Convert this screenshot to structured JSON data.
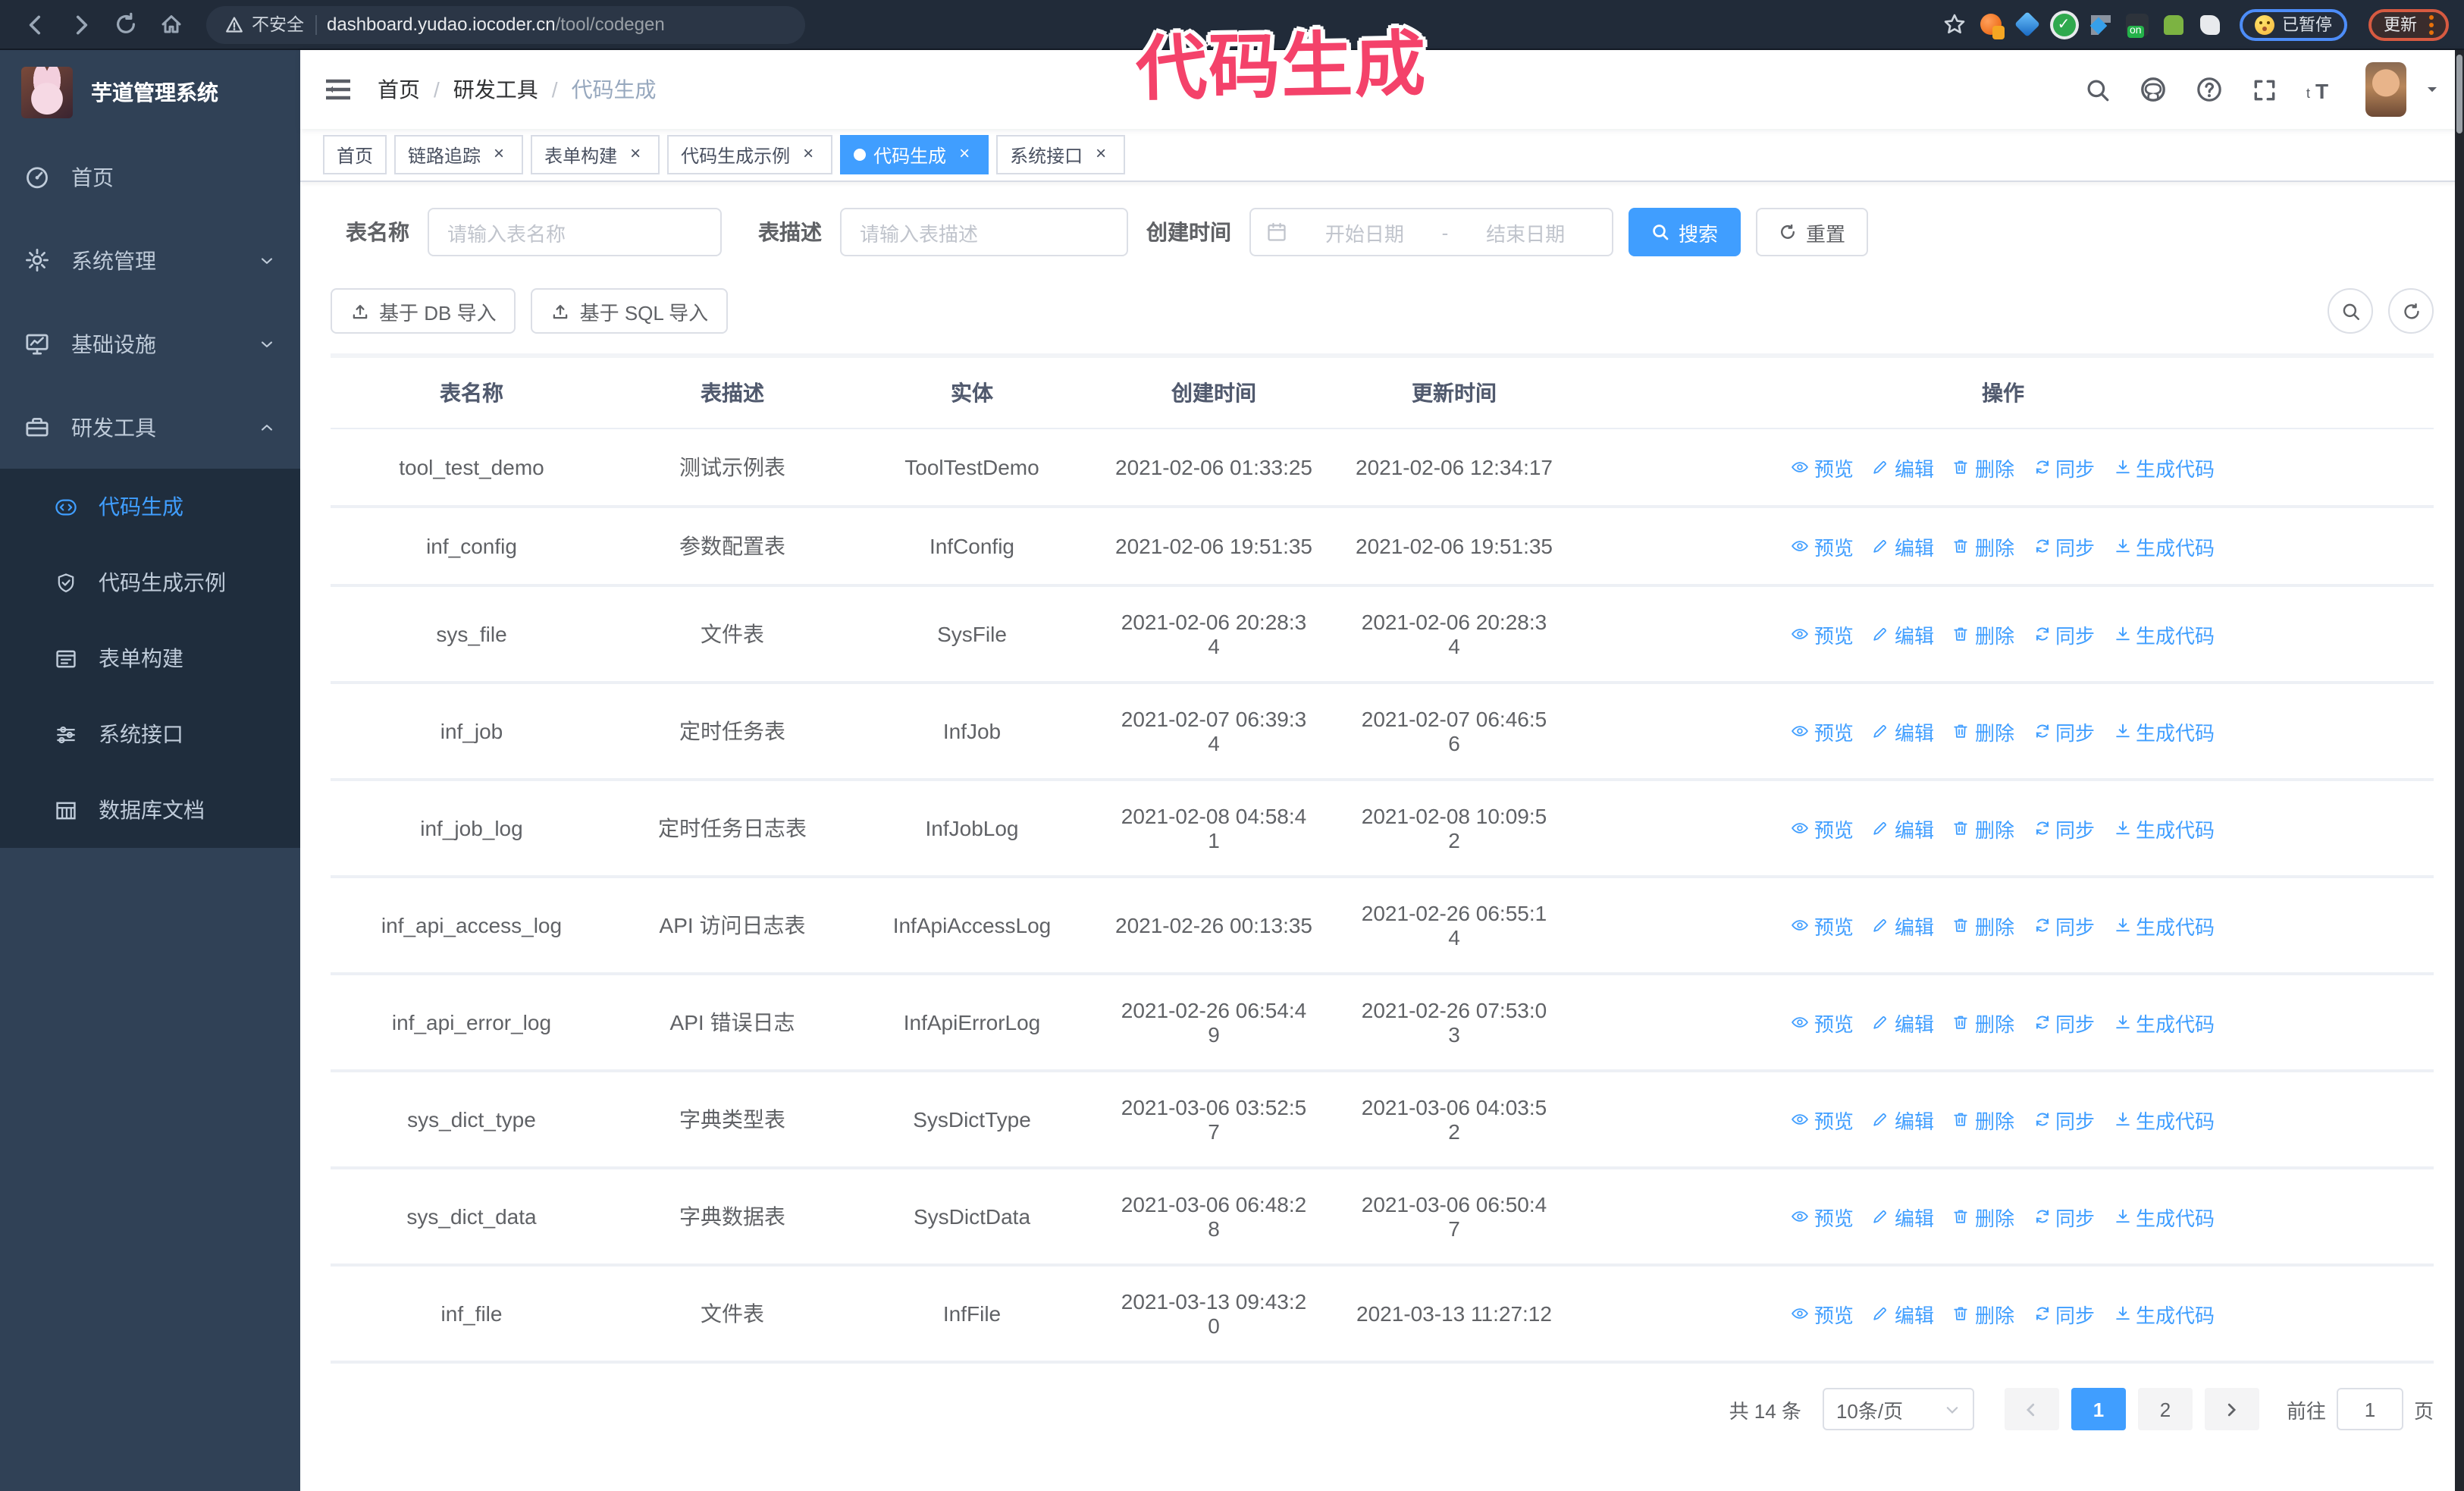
{
  "colors": {
    "accent": "#409eff",
    "sidebar_bg": "#304156",
    "submenu_bg": "#1f2d3d",
    "annotation": "#f4426a",
    "tag_active": "#409eff"
  },
  "annotation": {
    "text": "代码生成"
  },
  "browser": {
    "security_label": "不安全",
    "url_domain": "dashboard.yudao.iocoder.cn",
    "url_path": "/tool/codegen",
    "paused_badge": "已暂停",
    "update_button": "更新",
    "extensions": [
      "orange-extension-icon",
      "gem-extension-icon",
      "check-extension-icon",
      "grid-extension-icon",
      "on-extension-icon",
      "android-extension-icon",
      "puzzle-extension-icon"
    ]
  },
  "sidebar": {
    "title": "芋道管理系统",
    "items": [
      {
        "id": "home",
        "label": "首页",
        "icon": "dashboard"
      },
      {
        "id": "system",
        "label": "系统管理",
        "icon": "gear",
        "chevron": "down"
      },
      {
        "id": "infra",
        "label": "基础设施",
        "icon": "monitor",
        "chevron": "down"
      },
      {
        "id": "devtools",
        "label": "研发工具",
        "icon": "toolbox",
        "chevron": "up",
        "expanded": true
      }
    ],
    "submenu": [
      {
        "id": "codegen",
        "label": "代码生成",
        "icon": "code",
        "active": true
      },
      {
        "id": "codegen-example",
        "label": "代码生成示例",
        "icon": "badge"
      },
      {
        "id": "form-builder",
        "label": "表单构建",
        "icon": "form"
      },
      {
        "id": "system-api",
        "label": "系统接口",
        "icon": "sliders"
      },
      {
        "id": "db-doc",
        "label": "数据库文档",
        "icon": "dbdoc"
      }
    ]
  },
  "header": {
    "breadcrumb": [
      "首页",
      "研发工具",
      "代码生成"
    ]
  },
  "tags": [
    {
      "label": "首页",
      "closable": false,
      "active": false
    },
    {
      "label": "链路追踪",
      "closable": true,
      "active": false
    },
    {
      "label": "表单构建",
      "closable": true,
      "active": false
    },
    {
      "label": "代码生成示例",
      "closable": true,
      "active": false
    },
    {
      "label": "代码生成",
      "closable": true,
      "active": true
    },
    {
      "label": "系统接口",
      "closable": true,
      "active": false
    }
  ],
  "search": {
    "name_label": "表名称",
    "name_placeholder": "请输入表名称",
    "desc_label": "表描述",
    "desc_placeholder": "请输入表描述",
    "date_label": "创建时间",
    "date_start_placeholder": "开始日期",
    "date_separator": "-",
    "date_end_placeholder": "结束日期",
    "search_button": "搜索",
    "reset_button": "重置"
  },
  "toolbar": {
    "import_db": "基于 DB 导入",
    "import_sql": "基于 SQL 导入"
  },
  "table": {
    "columns": [
      "表名称",
      "表描述",
      "实体",
      "创建时间",
      "更新时间",
      "操作"
    ],
    "actions": [
      "预览",
      "编辑",
      "删除",
      "同步",
      "生成代码"
    ],
    "rows": [
      {
        "name": "tool_test_demo",
        "desc": "测试示例表",
        "entity": "ToolTestDemo",
        "created": "2021-02-06 01:33:25",
        "updated": "2021-02-06 12:34:17"
      },
      {
        "name": "inf_config",
        "desc": "参数配置表",
        "entity": "InfConfig",
        "created": "2021-02-06 19:51:35",
        "updated": "2021-02-06 19:51:35"
      },
      {
        "name": "sys_file",
        "desc": "文件表",
        "entity": "SysFile",
        "created": "2021-02-06 20:28:3\n4",
        "updated": "2021-02-06 20:28:3\n4"
      },
      {
        "name": "inf_job",
        "desc": "定时任务表",
        "entity": "InfJob",
        "created": "2021-02-07 06:39:3\n4",
        "updated": "2021-02-07 06:46:5\n6"
      },
      {
        "name": "inf_job_log",
        "desc": "定时任务日志表",
        "entity": "InfJobLog",
        "created": "2021-02-08 04:58:4\n1",
        "updated": "2021-02-08 10:09:5\n2"
      },
      {
        "name": "inf_api_access_log",
        "desc": "API 访问日志表",
        "entity": "InfApiAccessLog",
        "created": "2021-02-26 00:13:35",
        "updated": "2021-02-26 06:55:1\n4"
      },
      {
        "name": "inf_api_error_log",
        "desc": "API 错误日志",
        "entity": "InfApiErrorLog",
        "created": "2021-02-26 06:54:4\n9",
        "updated": "2021-02-26 07:53:0\n3"
      },
      {
        "name": "sys_dict_type",
        "desc": "字典类型表",
        "entity": "SysDictType",
        "created": "2021-03-06 03:52:5\n7",
        "updated": "2021-03-06 04:03:5\n2"
      },
      {
        "name": "sys_dict_data",
        "desc": "字典数据表",
        "entity": "SysDictData",
        "created": "2021-03-06 06:48:2\n8",
        "updated": "2021-03-06 06:50:4\n7"
      },
      {
        "name": "inf_file",
        "desc": "文件表",
        "entity": "InfFile",
        "created": "2021-03-13 09:43:2\n0",
        "updated": "2021-03-13 11:27:12"
      }
    ]
  },
  "pagination": {
    "total": "共 14 条",
    "page_size": "10条/页",
    "pages": [
      "1",
      "2"
    ],
    "active_page": "1",
    "goto_label": "前往",
    "goto_value": "1",
    "goto_suffix": "页"
  }
}
